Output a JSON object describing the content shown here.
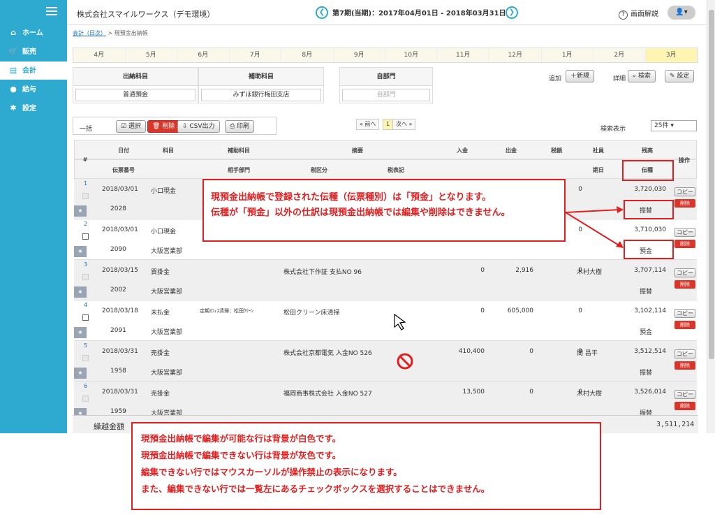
{
  "sidebar": {
    "items": [
      {
        "label": "ホーム",
        "icon": "home-icon",
        "glyph": "⌂"
      },
      {
        "label": "販売",
        "icon": "cart-icon",
        "glyph": "🛒"
      },
      {
        "label": "会計",
        "icon": "ledger-icon",
        "glyph": "▤"
      },
      {
        "label": "給与",
        "icon": "money-bag-icon",
        "glyph": "●"
      },
      {
        "label": "設定",
        "icon": "gear-icon",
        "glyph": "✱"
      }
    ]
  },
  "header": {
    "company": "株式会社スマイルワークス（デモ環境）",
    "period": "第7期(当期)：2017年04月01日 - 2018年03月31日",
    "prev": "❮",
    "next": "❯",
    "help_label": "画面解説",
    "help_q": "?",
    "user": "👤▾"
  },
  "breadcrumb": {
    "link": "会計（日次）",
    "sep": ">",
    "current": "現預金出納帳"
  },
  "months": [
    "4月",
    "5月",
    "6月",
    "7月",
    "8月",
    "9月",
    "10月",
    "11月",
    "12月",
    "1月",
    "2月",
    "3月"
  ],
  "filters": {
    "account_h": "出納科目",
    "account_v": "普通預金",
    "sub_h": "補助科目",
    "sub_v": "みずほ銀行梅田支店",
    "dept_h": "自部門",
    "dept_v": "自部門"
  },
  "toolbar": {
    "add_label": "追加",
    "new_btn": "＋新規",
    "detail_label": "詳細",
    "search_btn": "⌕ 検索",
    "settings_btn": "✎ 設定",
    "bulk_label": "一括",
    "select_btn": "☑ 選択",
    "delete_btn": "🗑 削除",
    "csv_btn": "⇩ CSV出力",
    "print_btn": "⎙ 印刷",
    "prev_page": "« 前へ",
    "page": "1",
    "next_page": "次へ »",
    "search_display_label": "検索表示",
    "per_page": "25件 ▾"
  },
  "table": {
    "h": {
      "no": "#",
      "date": "日付",
      "voucher_no": "伝票番号",
      "account": "科目",
      "sub": "補助科目",
      "partner_dept": "相手部門",
      "memo": "摘要",
      "tax_cat": "税区分",
      "tax_note": "税表記",
      "deposit": "入金",
      "withdraw": "出金",
      "tax": "税額",
      "staff": "社員",
      "due": "期日",
      "balance": "残高",
      "voucher_type": "伝種",
      "ops": "操作"
    },
    "copy": "コピー",
    "del": "削除",
    "rows": [
      {
        "n": "1",
        "date": "2018/03/01",
        "account": "小口現金",
        "sub": "",
        "memo": "",
        "deposit": "",
        "withdraw": "",
        "tax": "0",
        "staff": "",
        "balance": "3,720,030",
        "vno": "2028",
        "dept": "",
        "vtype": "振替"
      },
      {
        "n": "2",
        "date": "2018/03/01",
        "account": "小口現金",
        "sub": "",
        "memo": "",
        "deposit": "",
        "withdraw": "",
        "tax": "0",
        "staff": "",
        "balance": "3,710,030",
        "vno": "2090",
        "dept": "大阪営業部",
        "vtype": "預金"
      },
      {
        "n": "3",
        "date": "2018/03/15",
        "account": "買掛金",
        "sub": "",
        "memo": "株式会社下作証 支払NO 96",
        "deposit": "0",
        "withdraw": "2,916",
        "tax": "0",
        "staff": "木村大樹",
        "balance": "3,707,114",
        "vno": "2002",
        "dept": "大阪営業部",
        "vtype": "振替"
      },
      {
        "n": "4",
        "date": "2018/03/18",
        "account": "未払金",
        "sub": "定期ｵﾌｨｽ清掃：松田ｸﾘｰﾝ",
        "memo": "松田クリーン床清掃",
        "deposit": "0",
        "withdraw": "605,000",
        "tax": "0",
        "staff": "",
        "balance": "3,102,114",
        "vno": "2091",
        "dept": "大阪営業部",
        "vtype": "預金"
      },
      {
        "n": "5",
        "date": "2018/03/31",
        "account": "売掛金",
        "sub": "",
        "memo": "株式会社京都電気 入金NO 526",
        "deposit": "410,400",
        "withdraw": "0",
        "tax": "0",
        "staff": "間 昌平",
        "balance": "3,512,514",
        "vno": "1958",
        "dept": "大阪営業部",
        "vtype": "振替"
      },
      {
        "n": "6",
        "date": "2018/03/31",
        "account": "売掛金",
        "sub": "",
        "memo": "福岡商事株式会社 入金NO 527",
        "deposit": "13,500",
        "withdraw": "0",
        "tax": "0",
        "staff": "木村大樹",
        "balance": "3,526,014",
        "vno": "1959",
        "dept": "大阪営業部",
        "vtype": "振替"
      }
    ]
  },
  "footer": {
    "label": "繰越金額",
    "amount": "3,511,214"
  },
  "callouts": {
    "c1_l1": "現預金出納帳で登録された伝種（伝票種別）は「預金」となります。",
    "c1_l2": "伝種が「預金」以外の仕訳は現預金出納帳では編集や削除はできません。",
    "c2_l1": "現預金出納帳で編集が可能な行は背景が白色です。",
    "c2_l2": "現預金出納帳で編集できない行は背景が灰色です。",
    "c2_l3": "編集できない行ではマウスカーソルが操作禁止の表示になります。",
    "c2_l4": "また、編集できない行では一覧左にあるチェックボックスを選択することはできません。"
  },
  "colors": {
    "sidebar": "#2eaad1",
    "accent_red": "#e02020",
    "disabled_row": "#efefef"
  }
}
